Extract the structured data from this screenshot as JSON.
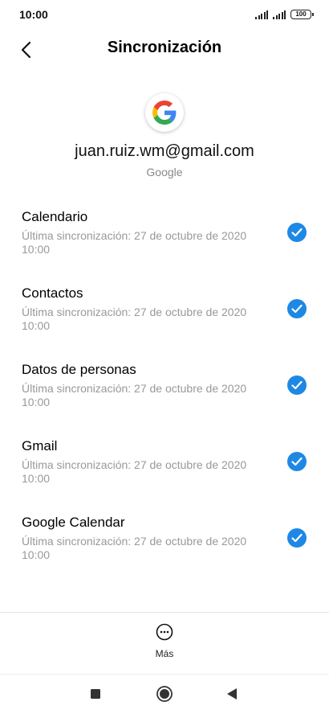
{
  "status_bar": {
    "time": "10:00",
    "battery": "100",
    "icons": [
      "signal-icon",
      "signal-icon",
      "battery-icon"
    ]
  },
  "header": {
    "title": "Sincronización",
    "back_icon": "chevron-left-icon"
  },
  "account": {
    "logo": "google-logo",
    "email": "juan.ruiz.wm@gmail.com",
    "type": "Google"
  },
  "sync_items": [
    {
      "name": "Calendario",
      "status": "Última sincronización: 27 de octubre de 2020 10:00",
      "checked": true
    },
    {
      "name": "Contactos",
      "status": "Última sincronización: 27 de octubre de 2020 10:00",
      "checked": true
    },
    {
      "name": "Datos de personas",
      "status": "Última sincronización: 27 de octubre de 2020 10:00",
      "checked": true
    },
    {
      "name": "Gmail",
      "status": "Última sincronización: 27 de octubre de 2020 10:00",
      "checked": true
    },
    {
      "name": "Google Calendar",
      "status": "Última sincronización: 27 de octubre de 2020 10:00",
      "checked": true
    }
  ],
  "more": {
    "label": "Más",
    "icon": "more-options-icon"
  },
  "navbar": {
    "icons": [
      "recents-square-icon",
      "home-circle-icon",
      "back-triangle-icon"
    ]
  },
  "colors": {
    "accent": "#1e88e5",
    "secondary_text": "#999999"
  }
}
